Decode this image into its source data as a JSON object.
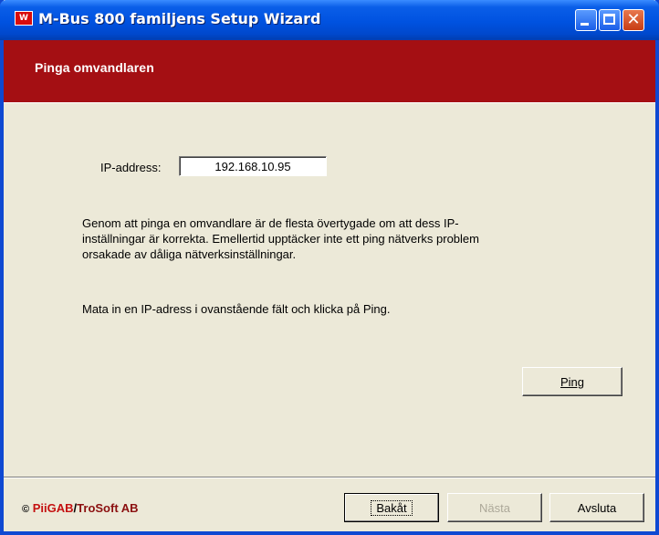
{
  "window": {
    "title": "M-Bus 800 familjens Setup Wizard",
    "app_icon_text": "W",
    "close_glyph": "✕"
  },
  "header": {
    "title": "Pinga omvandlaren"
  },
  "form": {
    "ip_label": "IP-address:",
    "ip_value": "192.168.10.95"
  },
  "description": {
    "paragraph1": "Genom att pinga en omvandlare är de flesta övertygade om att dess IP-inställningar är korrekta. Emellertid upptäcker inte ett ping nätverks problem orsakade av dåliga nätverksinställningar.",
    "paragraph2": "Mata in en IP-adress i ovanstående fält och klicka på Ping."
  },
  "buttons": {
    "ping": "Ping",
    "back": "Bakåt",
    "next": "Nästa",
    "exit": "Avsluta"
  },
  "footer": {
    "copyright_symbol": "©",
    "company1": "PiiGAB",
    "slash": "/",
    "company2": "TroSoft AB"
  },
  "colors": {
    "header_band": "#a40f13",
    "titlebar": "#0052e0",
    "window_bg": "#ece9d8"
  }
}
